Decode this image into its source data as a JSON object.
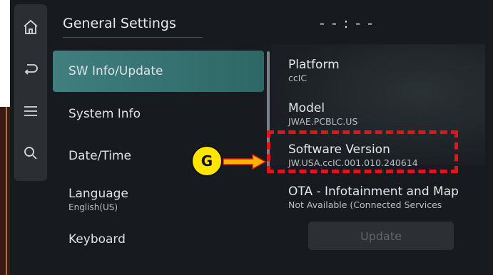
{
  "header": {
    "title": "General Settings",
    "clock": "- - : - -"
  },
  "icon_bar": {
    "items": [
      {
        "icon": "home-icon"
      },
      {
        "icon": "back-icon"
      },
      {
        "icon": "menu-icon"
      },
      {
        "icon": "search-icon"
      }
    ]
  },
  "menu": {
    "items": [
      {
        "label": "SW Info/Update",
        "active": true
      },
      {
        "label": "System Info"
      },
      {
        "label": "Date/Time"
      },
      {
        "label": "Language",
        "sub": "English(US)"
      },
      {
        "label": "Keyboard"
      }
    ]
  },
  "info": {
    "platform": {
      "label": "Platform",
      "value": "ccIC"
    },
    "model": {
      "label": "Model",
      "value": "JWAE.PCBLC.US"
    },
    "software": {
      "label": "Software Version",
      "value": "JW.USA.ccIC.001.010.240614"
    },
    "ota": {
      "label": "OTA - Infotainment and Map",
      "value": "Not Available (Connected Services"
    }
  },
  "update_button": {
    "label": "Update"
  },
  "annotation": {
    "badge": "G"
  },
  "colors": {
    "active_item": "#3f7f7e",
    "callout": "#e0141a",
    "badge": "#ffe600"
  }
}
